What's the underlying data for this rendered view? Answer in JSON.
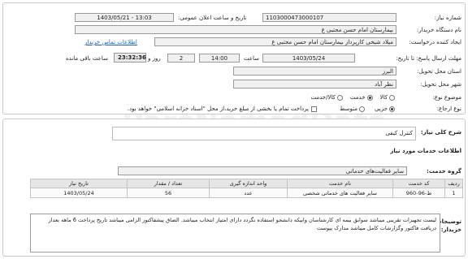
{
  "need_number": {
    "label": "شماره نیاز:",
    "value": "1103000473000107"
  },
  "announce_datetime": {
    "label": "تاریخ و ساعت اعلان عمومی:",
    "value": "1403/05/21 - 13:03"
  },
  "buyer_name": {
    "label": "نام دستگاه خریدار:",
    "value": "بیمارستان امام حسن مجتبی ع"
  },
  "creator": {
    "label": "ایجاد کننده درخواست:",
    "value": "میلاد شیخی کارپرداز بیمارستان امام حسن مجتبی ع",
    "contact_link": "اطلاعات تماس خریدار"
  },
  "deadline": {
    "label": "مهلت ارسال پاسخ: تا تاریخ:",
    "date": "1403/05/24",
    "time_label": "ساعت",
    "time": "14:00",
    "days": "2",
    "days_label": "روز و",
    "remaining": "23:32:36",
    "remaining_label": "ساعت باقی مانده"
  },
  "province": {
    "label": "استان محل تحویل:",
    "value": "البرز"
  },
  "city": {
    "label": "شهر محل تحویل:",
    "value": "نظر آباد"
  },
  "category": {
    "label": "موضوع نوع:",
    "options": [
      {
        "label": "کالا",
        "selected": false
      },
      {
        "label": "خدمت",
        "selected": true
      },
      {
        "label": "کالا/خدمت",
        "selected": false
      }
    ]
  },
  "payment": {
    "label": "نوع ارجاع:",
    "options": [
      {
        "label": "جزیی",
        "selected": true
      },
      {
        "label": "متوسط",
        "selected": false
      }
    ],
    "note": "پرداخت تمام یا بخشی از مبلغ خرید،از محل \"اسناد خزانه اسلامی\" خواهد بود."
  },
  "general_desc": {
    "label": "شرح کلی نیاز:",
    "value": "کنترل کیفی"
  },
  "services_title": "اطلاعات خدمات مورد نیاز",
  "service_group": {
    "label": "گروه خدمت:",
    "value": "سایر فعالیت‌های خدماتی"
  },
  "table": {
    "headers": [
      "ردیف",
      "کد خدمت",
      "نام خدمت",
      "واحد اندازه گیری",
      "تعداد / مقدار",
      "تاریخ نیاز"
    ],
    "rows": [
      [
        "1",
        "ط-96-960",
        "سایر فعالیت های خدماتی شخصی",
        "عدد",
        "56",
        "1403/05/24"
      ]
    ]
  },
  "buyer_notes": {
    "label": "توضیحات خریدار:",
    "value": "لیست تجهیزات تقریبی میباشد سوابق بیمه ای کارشناسان وابیکه دانشجو استفاده نگردد دارای امتیاز انتخاب میباشد. الصاق پیشفاکتور الزامی میباشد تاریخ پرداخت 6 ماهه بعداز دریافت فاکتور وگزارشات کامل میباشد مدارک پیوست"
  },
  "watermarks": [
    "ParsNamadData",
    "پارس نماد داده",
    "مرکز اطلاع رسانی مناقصات و مزایدات"
  ]
}
